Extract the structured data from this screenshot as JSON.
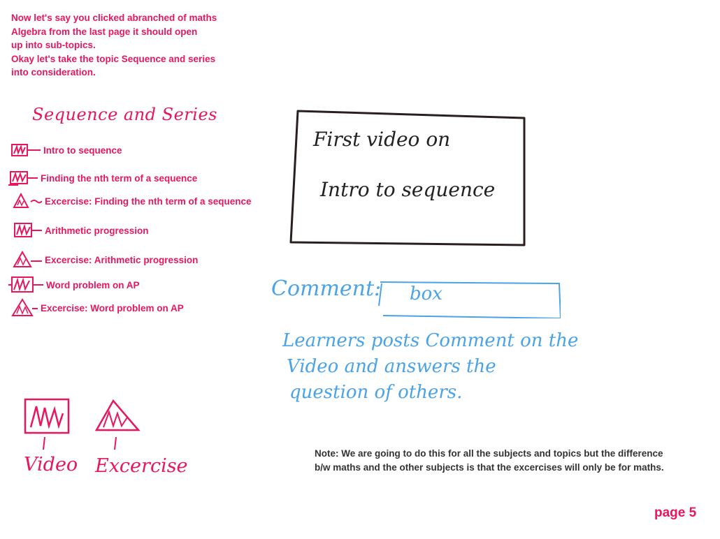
{
  "intro": {
    "lines": [
      "Now let's say you clicked abranched of maths",
      " Algebra from the last page it should open",
      " up into sub-topics.",
      "Okay let's take the topic Sequence and series",
      "into consideration."
    ]
  },
  "section_title": "Sequence and Series",
  "topics": [
    {
      "label": "Intro to sequence",
      "icon": "video-icon"
    },
    {
      "label": "Finding the nth term of a sequence",
      "icon": "video-icon"
    },
    {
      "label": "Excercise: Finding the nth term of a sequence",
      "icon": "exercise-icon"
    },
    {
      "label": "Arithmetic progression",
      "icon": "video-icon"
    },
    {
      "label": "Excercise: Arithmetic progression",
      "icon": "exercise-icon"
    },
    {
      "label": "Word problem on AP",
      "icon": "video-icon"
    },
    {
      "label": "Excercise: Word problem on AP",
      "icon": "exercise-icon"
    }
  ],
  "video_player": {
    "line1": "First video on",
    "line2": "Intro to sequence"
  },
  "comment": {
    "label": "Comment:",
    "box_text": "box"
  },
  "description": {
    "lines": [
      "Learners posts Comment on the",
      "Video and answers the",
      "question of others."
    ]
  },
  "legend": {
    "video_label": "Video",
    "exercise_label": "Excercise"
  },
  "note": {
    "lines": [
      "Note: We are going to do this for all the subjects and topics but the difference",
      "b/w maths and the other subjects is that the excercises will only be for maths."
    ]
  },
  "page_number": "page 5",
  "colors": {
    "pink": "#e8175d",
    "blue": "#4aa3e8",
    "dark": "#222222"
  }
}
